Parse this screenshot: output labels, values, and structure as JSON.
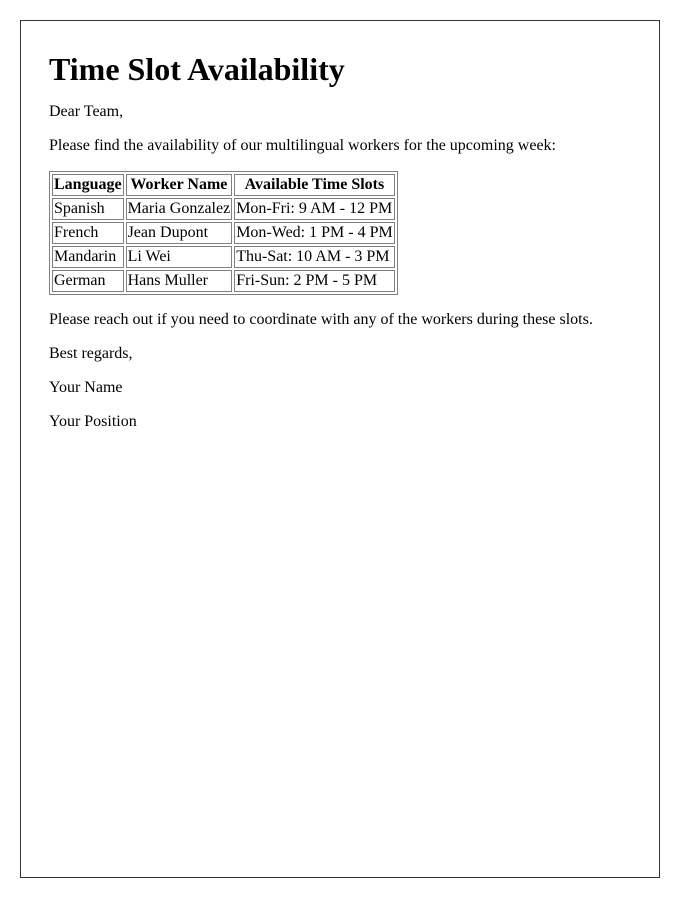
{
  "title": "Time Slot Availability",
  "greeting": "Dear Team,",
  "intro": "Please find the availability of our multilingual workers for the upcoming week:",
  "table": {
    "headers": [
      "Language",
      "Worker Name",
      "Available Time Slots"
    ],
    "rows": [
      [
        "Spanish",
        "Maria Gonzalez",
        "Mon-Fri: 9 AM - 12 PM"
      ],
      [
        "French",
        "Jean Dupont",
        "Mon-Wed: 1 PM - 4 PM"
      ],
      [
        "Mandarin",
        "Li Wei",
        "Thu-Sat: 10 AM - 3 PM"
      ],
      [
        "German",
        "Hans Muller",
        "Fri-Sun: 2 PM - 5 PM"
      ]
    ]
  },
  "closing_note": "Please reach out if you need to coordinate with any of the workers during these slots.",
  "sign_off": "Best regards,",
  "signature_name": "Your Name",
  "signature_position": "Your Position"
}
